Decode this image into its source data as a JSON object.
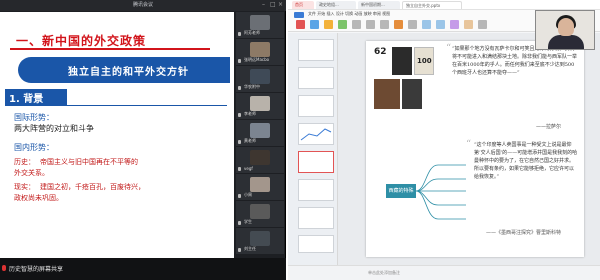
{
  "meeting": {
    "window_title": "腾讯会议",
    "slide": {
      "title": "一、新中国的外交政策",
      "subtitle": "独立自主的和平外交方针",
      "section": "1. 背景",
      "intl_heading": "国际形势：",
      "intl_text": "两大阵营的对立和斗争",
      "domestic_heading": "国内形势：",
      "history_label": "历史：",
      "history_text_1": "帝国主义与旧中国再在不平等的",
      "history_text_2": "外交关系。",
      "reality_label": "现实：",
      "reality_text_1": "建国之初，千疮百孔，百废待兴，",
      "reality_text_2": "政权尚未巩固。"
    },
    "bottom_name": "历史智慧的屏幕共享",
    "participants": [
      {
        "label": "阿芳老师",
        "color": "#6b6f75"
      },
      {
        "label": "张明远Macbo",
        "color": "#8d7a66"
      },
      {
        "label": "华农附中",
        "color": "#3f4a57"
      },
      {
        "label": "李老师",
        "color": "#b8b2aa"
      },
      {
        "label": "黄老师",
        "color": "#7c8591"
      },
      {
        "label": "vegf",
        "color": "#3e3630"
      },
      {
        "label": "小周",
        "color": "#a3968c"
      },
      {
        "label": "学生",
        "color": "#5a5a5a"
      },
      {
        "label": "刘主任",
        "color": "#444b52"
      }
    ]
  },
  "wps": {
    "tabs": {
      "home": "首页",
      "file1": "政史地组...",
      "file2": "新中国初期...",
      "active": "独立自主外交.pptx"
    },
    "menu": "文件  开始  插入  设计  切换  动画  放映  审阅  视图",
    "slide": {
      "book_num_1": "62",
      "book_num_2": "100",
      "quote_1": "“如果那个地方没有瓦萨卡尔和可笑且乃际的分裂，我们将不可能进入和满结那块土地。除非我们能与西军队一举在百米1000年的乎人。而任何我们来至底不少达到500个西班牙人也还算不能夺——”",
      "author_1": "——拉萨尔",
      "mindmap_label": "西藏的特殊",
      "quote_2": "“这个印度等人卖国事是一种受文上说是最仰第‘交人后国’的——可能增添并国是我我刻的哈曼种怀中的要为了，在它自然己国之好并求。所以要有条约，如果它能够拒绝，它应许可以给我恢复。”",
      "author_2": "——《墨西哥注探究》曹里斯科特"
    },
    "status_note": "单击此处添加备注"
  }
}
